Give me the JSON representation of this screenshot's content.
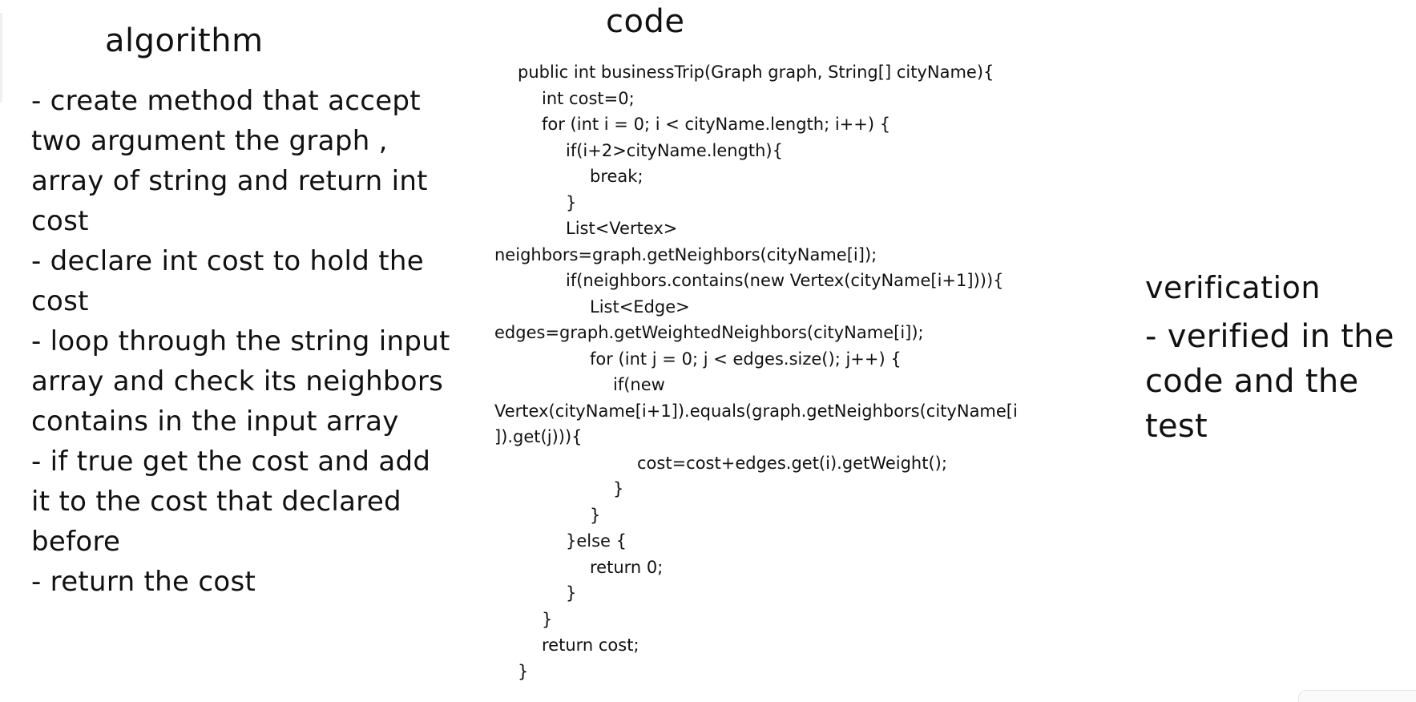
{
  "headings": {
    "algorithm": "algorithm",
    "code": "code",
    "verification": "verification"
  },
  "algorithm_lines": [
    "- create method that accept",
    "two argument the graph ,",
    "array of string and return int",
    "cost",
    "- declare int cost to hold the",
    "cost",
    "- loop through the string input",
    "array and check its neighbors",
    "contains in the input array",
    "- if true get the cost and add",
    "it to the cost that declared",
    "before",
    "- return the cost"
  ],
  "code_lines": [
    "public int businessTrip(Graph graph, String[] cityName){",
    "int cost=0;",
    "for (int i = 0; i < cityName.length; i++) {",
    "if(i+2>cityName.length){",
    "break;",
    "}",
    "List<Vertex>",
    "neighbors=graph.getNeighbors(cityName[i]);",
    "if(neighbors.contains(new Vertex(cityName[i+1]))){",
    "List<Edge>",
    "edges=graph.getWeightedNeighbors(cityName[i]);",
    "for (int j = 0; j < edges.size(); j++) {",
    "if(new",
    "Vertex(cityName[i+1]).equals(graph.getNeighbors(cityName[i",
    "]).get(j))){",
    "cost=cost+edges.get(i).getWeight();",
    "}",
    "}",
    "}else {",
    "return 0;",
    "}",
    "}",
    "return cost;",
    "}"
  ],
  "verification_lines": [
    "- verified in the",
    "code and the",
    "test"
  ]
}
